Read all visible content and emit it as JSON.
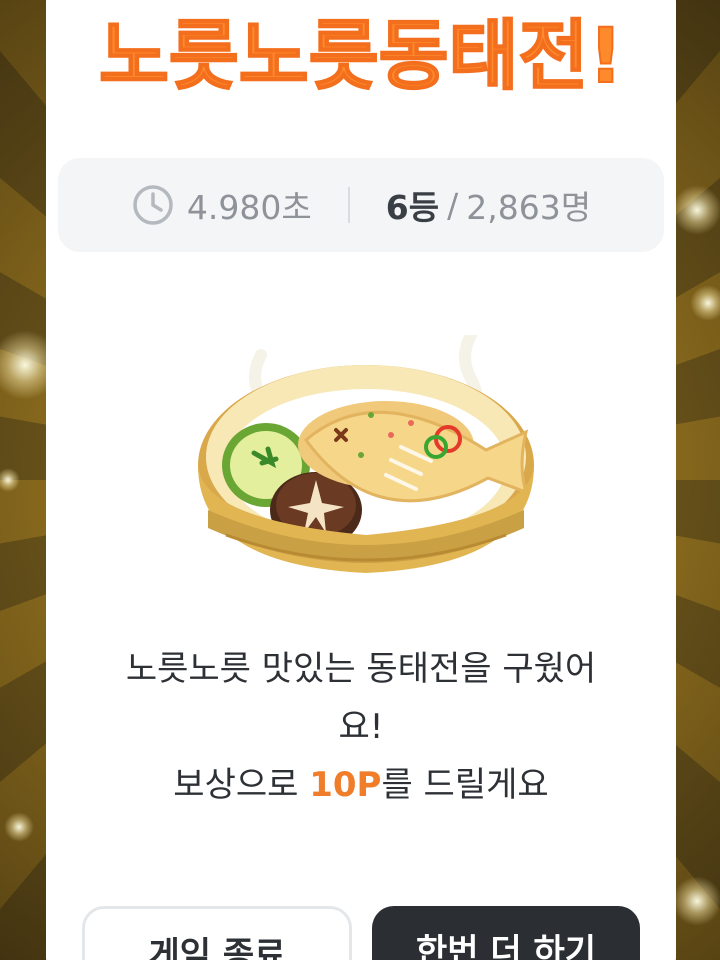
{
  "title": "노릇노릇동태전!",
  "stats": {
    "time": "4.980초",
    "rank": "6등",
    "slash": "/",
    "participants": "2,863명"
  },
  "message": {
    "line1": "노릇노릇 맛있는 동태전을 구웠어",
    "line2": "요!",
    "reward_prefix": "보상으로 ",
    "reward_points": "10P",
    "reward_suffix": "를 드릴게요"
  },
  "buttons": {
    "exit_label": "게임 종료",
    "again_label": "한번 더 하기"
  },
  "colors": {
    "title_fill": "#ff8a2b",
    "title_outline": "#ffffff",
    "accent_points": "#f07d2a",
    "dark_button": "#2b2f33"
  },
  "icons": {
    "timer": "clock-icon",
    "illustration": "fish-jeon-in-bamboo-steamer"
  }
}
